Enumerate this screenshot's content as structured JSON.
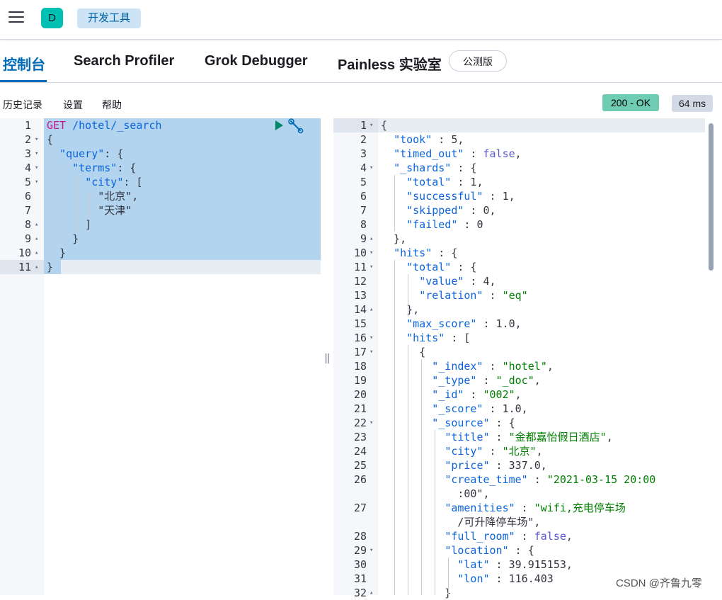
{
  "header": {
    "avatar_letter": "D",
    "breadcrumb": "开发工具"
  },
  "tabs": [
    {
      "label": "控制台",
      "active": true
    },
    {
      "label": "Search Profiler"
    },
    {
      "label": "Grok Debugger"
    },
    {
      "label": "Painless 实验室"
    }
  ],
  "beta_badge": "公测版",
  "toolbar": {
    "history": "历史记录",
    "settings": "设置",
    "help": "帮助",
    "status": "200 - OK",
    "timing": "64 ms"
  },
  "request": {
    "method": "GET",
    "path": " /hotel/_search",
    "line_numbers": [
      "1",
      "2",
      "3",
      "4",
      "5",
      "6",
      "7",
      "8",
      "9",
      "10",
      "11"
    ],
    "lines": [
      "{",
      "  \"query\": {",
      "    \"terms\": {",
      "      \"city\": [",
      "        \"北京\",",
      "        \"天津\"",
      "      ]",
      "    }",
      "  }",
      "}"
    ]
  },
  "response": {
    "line_numbers": [
      "1",
      "2",
      "3",
      "4",
      "5",
      "6",
      "7",
      "8",
      "9",
      "10",
      "11",
      "12",
      "13",
      "14",
      "15",
      "16",
      "17",
      "18",
      "19",
      "20",
      "21",
      "22",
      "23",
      "24",
      "25",
      "26",
      "",
      "27",
      "",
      "28",
      "29",
      "30",
      "31",
      "32"
    ],
    "lines": [
      "{",
      "  \"took\" : 5,",
      "  \"timed_out\" : false,",
      "  \"_shards\" : {",
      "    \"total\" : 1,",
      "    \"successful\" : 1,",
      "    \"skipped\" : 0,",
      "    \"failed\" : 0",
      "  },",
      "  \"hits\" : {",
      "    \"total\" : {",
      "      \"value\" : 4,",
      "      \"relation\" : \"eq\"",
      "    },",
      "    \"max_score\" : 1.0,",
      "    \"hits\" : [",
      "      {",
      "        \"_index\" : \"hotel\",",
      "        \"_type\" : \"_doc\",",
      "        \"_id\" : \"002\",",
      "        \"_score\" : 1.0,",
      "        \"_source\" : {",
      "          \"title\" : \"金都嘉怡假日酒店\",",
      "          \"city\" : \"北京\",",
      "          \"price\" : 337.0,",
      "          \"create_time\" : \"2021-03-15 20:00",
      "            :00\",",
      "          \"amenities\" : \"wifi,充电停车场",
      "            /可升降停车场\",",
      "          \"full_room\" : false,",
      "          \"location\" : {",
      "            \"lat\" : 39.915153,",
      "            \"lon\" : 116.403",
      "          }"
    ]
  },
  "watermark": "CSDN @齐鲁九零"
}
